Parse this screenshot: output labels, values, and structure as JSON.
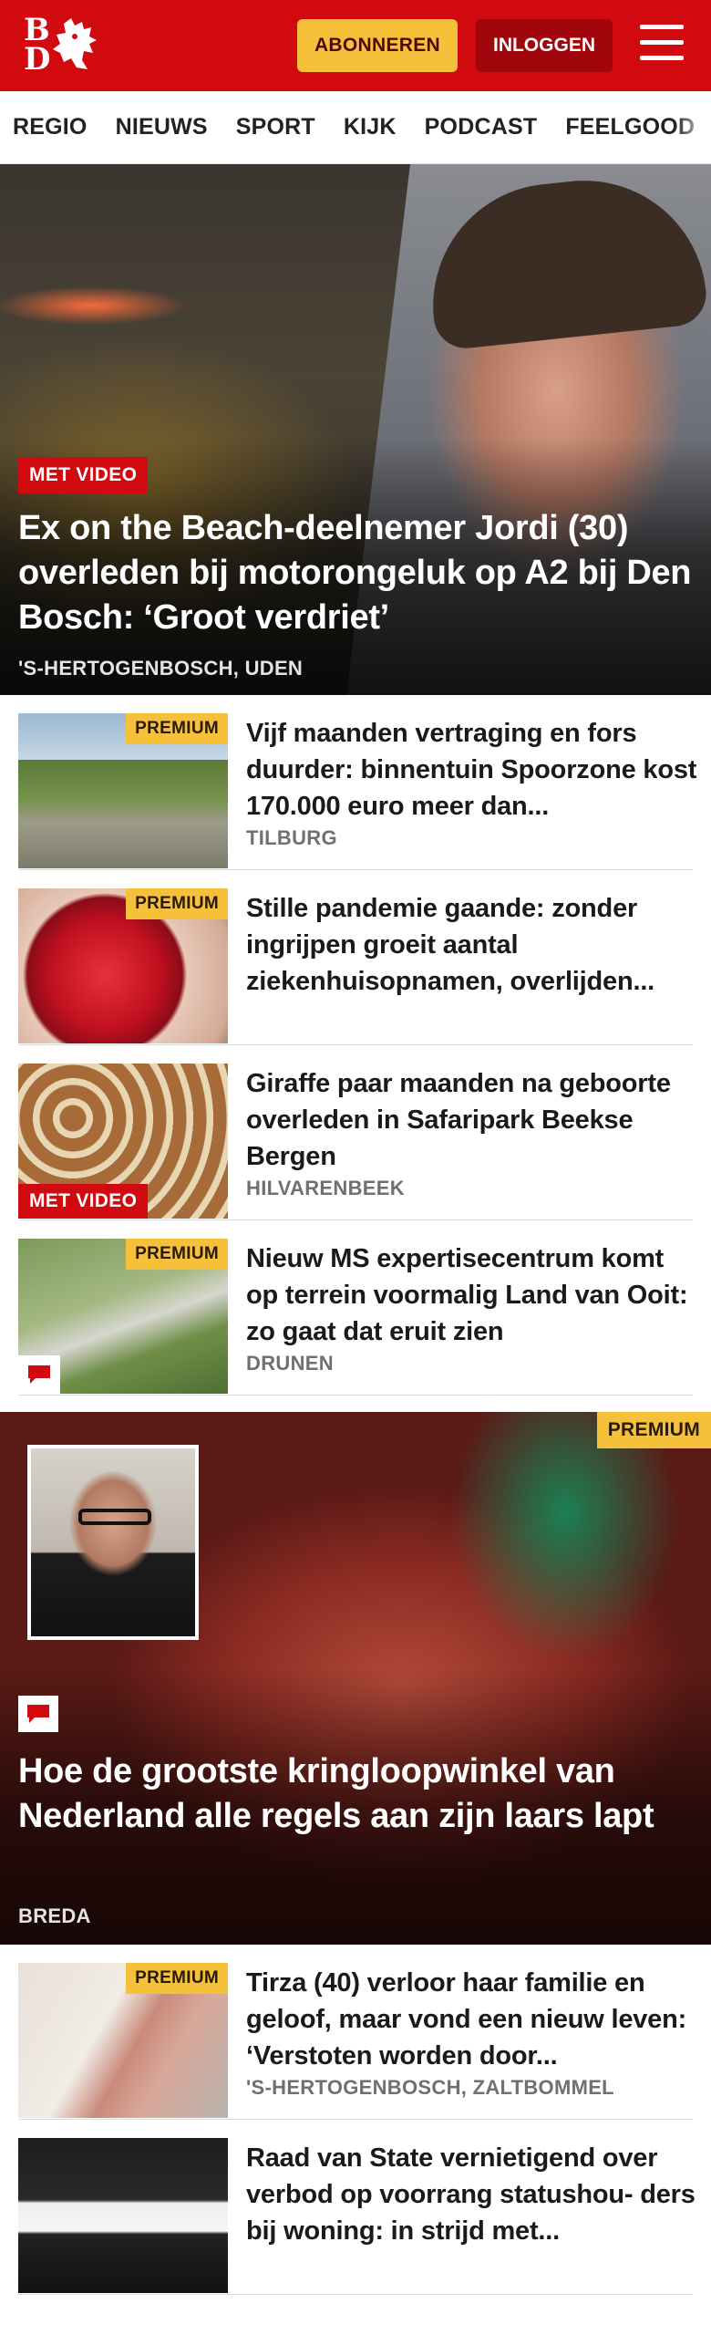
{
  "header": {
    "logo_b": "B",
    "logo_d": "D",
    "subscribe_label": "ABONNEREN",
    "login_label": "INLOGGEN"
  },
  "nav": {
    "items": [
      "REGIO",
      "NIEUWS",
      "SPORT",
      "KIJK",
      "PODCAST",
      "FEELGOOD"
    ]
  },
  "hero": {
    "badge": "MET VIDEO",
    "title": "Ex on the Beach-deelnemer Jordi (30) overleden bij motorongeluk op A2 bij Den Bosch: ‘Groot verdriet’",
    "location": "'S-HERTOGENBOSCH, UDEN"
  },
  "articles": [
    {
      "title": "Vijf maanden vertraging en fors duurder: binnentuin Spoorzone kost 170.000 euro meer dan...",
      "location": "TILBURG",
      "badge": "PREMIUM"
    },
    {
      "title": "Stille pandemie gaande: zonder ingrijpen groeit aantal ziekenhuisopnamen, overlijden...",
      "location": "",
      "badge": "PREMIUM"
    },
    {
      "title": "Giraffe paar maanden na geboorte overleden in Safaripark Beekse Bergen",
      "location": "HILVARENBEEK",
      "badge": "MET VIDEO"
    },
    {
      "title": "Nieuw MS expertisecentrum komt op terrein voormalig Land van Ooit: zo gaat dat eruit zien",
      "location": "DRUNEN",
      "badge": "PREMIUM"
    }
  ],
  "feature": {
    "badge": "PREMIUM",
    "title": "Hoe de grootste kringloopwinkel van Nederland alle regels aan zijn laars lapt",
    "location": "BREDA"
  },
  "articles2": [
    {
      "title": "Tirza (40) verloor haar familie en geloof, maar vond een nieuw leven: ‘Verstoten worden door...",
      "location": "'S-HERTOGENBOSCH, ZALTBOMMEL",
      "badge": "PREMIUM"
    },
    {
      "title": "Raad van State vernietigend over verbod op voorrang statushou- ders bij woning: in strijd met...",
      "location": ""
    }
  ],
  "colors": {
    "brand_red": "#d10a10",
    "premium_yellow": "#f5c03a",
    "login_red": "#a0060b"
  }
}
